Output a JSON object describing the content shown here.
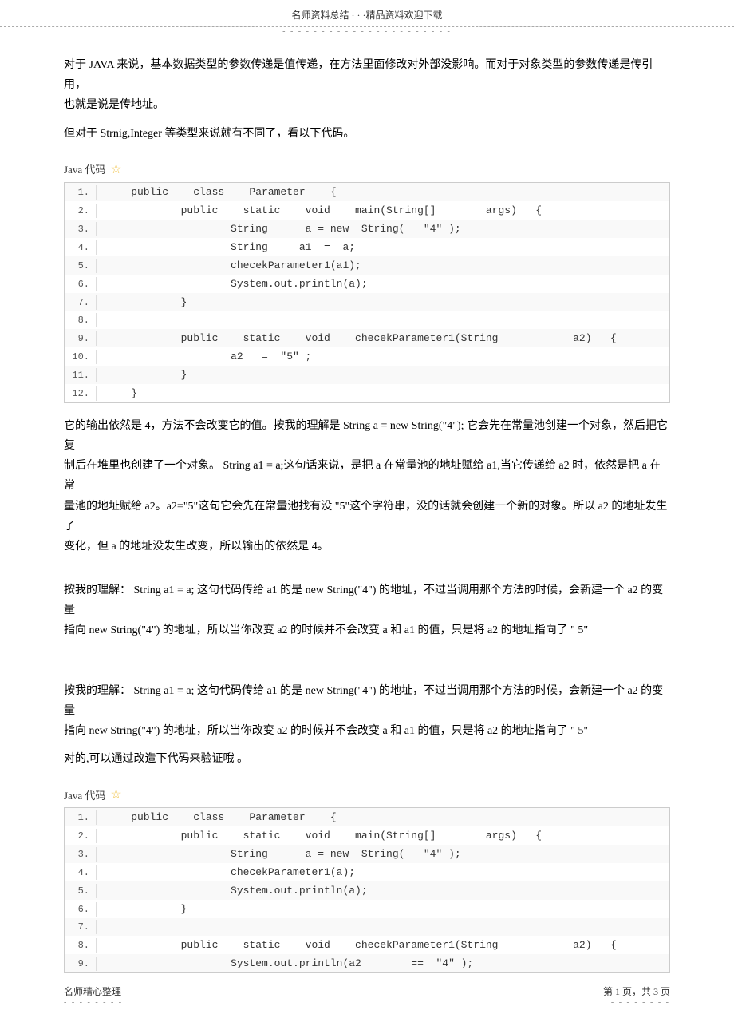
{
  "header": {
    "title": "名师资料总结 · · ·精品资料欢迎下载",
    "dots": "- - - - - - - - - - - - - - - - - - - - - -"
  },
  "paragraphs": {
    "p1": "对于 JAVA 来说，基本数据类型的参数传递是值传递，在方法里面修改对外部没影响。而对于对象类型的参数传递是传引用，",
    "p2": "也就是说是传地址。",
    "p3": "但对于 Strnig,Integer 等类型来说就有不同了，看以下代码。",
    "section1_label": "Java 代码",
    "code1": [
      {
        "num": "1.",
        "content": "    public    class    Parameter    {"
      },
      {
        "num": "2.",
        "content": "            public    static    void    main(String[]        args)   {"
      },
      {
        "num": "3.",
        "content": "                    String      a = new  String(   \"4\" );"
      },
      {
        "num": "4.",
        "content": "                    String     a1  =  a;"
      },
      {
        "num": "5.",
        "content": "                    checekParameter1(a1);"
      },
      {
        "num": "6.",
        "content": "                    System.out.println(a);"
      },
      {
        "num": "7.",
        "content": "            }"
      },
      {
        "num": "8.",
        "content": ""
      },
      {
        "num": "9.",
        "content": "            public    static    void    checekParameter1(String            a2)   {"
      },
      {
        "num": "10.",
        "content": "                    a2   =  \"5\" ;"
      },
      {
        "num": "11.",
        "content": "            }"
      },
      {
        "num": "12.",
        "content": "    }"
      }
    ],
    "p4": "它的输出依然是   4，方法不会改变它的值。按我的理解是      String  a = new String(\"4\"); 它会先在常量池创建一个对象，然后把它复",
    "p5": "制后在堆里也创建了一个对象。       String  a1 = a;这句话来说，是把   a 在常量池的地址赋给    a1,当它传递给  a2 时，依然是把   a 在常",
    "p6": "量池的地址赋给    a2。a2=\"5\"这句它会先在常量池找有没     \"5\"这个字符串，没的话就会创建一个新的对象。所以           a2 的地址发生了",
    "p7": "变化，但  a 的地址没发生改变，所以输出的依然是       4。",
    "spacer1": "",
    "p8": "按我的理解：  String  a1 = a; 这句代码传给   a1 的是 new String(\"4\") 的地址，不过当调用那个方法的时候，会新建一个         a2 的变量",
    "p9": "指向 new String(\"4\") 的地址，所以当你改变    a2 的时候并不会改变   a 和 a1 的值，只是将  a2 的地址指向了 \" 5\"",
    "spacer2": "",
    "p10": "按我的理解：  String  a1 = a; 这句代码传给   a1 的是 new String(\"4\") 的地址，不过当调用那个方法的时候，会新建一个         a2 的变量",
    "p11": "指向 new String(\"4\") 的地址，所以当你改变    a2 的时候并不会改变   a 和 a1 的值，只是将  a2 的地址指向了 \" 5\"",
    "p12": "对的,可以通过改造下代码来验证哦    。",
    "section2_label": "Java 代码",
    "code2": [
      {
        "num": "1.",
        "content": "    public    class    Parameter    {"
      },
      {
        "num": "2.",
        "content": "            public    static    void    main(String[]        args)   {"
      },
      {
        "num": "3.",
        "content": "                    String      a = new  String(   \"4\" );"
      },
      {
        "num": "4.",
        "content": "                    checekParameter1(a);"
      },
      {
        "num": "5.",
        "content": "                    System.out.println(a);"
      },
      {
        "num": "6.",
        "content": "            }"
      },
      {
        "num": "7.",
        "content": ""
      },
      {
        "num": "8.",
        "content": "            public    static    void    checekParameter1(String            a2)   {"
      },
      {
        "num": "9.",
        "content": "                    System.out.println(a2        ==  \"4\" );"
      }
    ]
  },
  "footer": {
    "left_label": "名师精心整理",
    "left_dots": "- - - - - - - -",
    "right_label": "第 1 页，共 3 页",
    "right_dots": "- - - - - - - -"
  }
}
